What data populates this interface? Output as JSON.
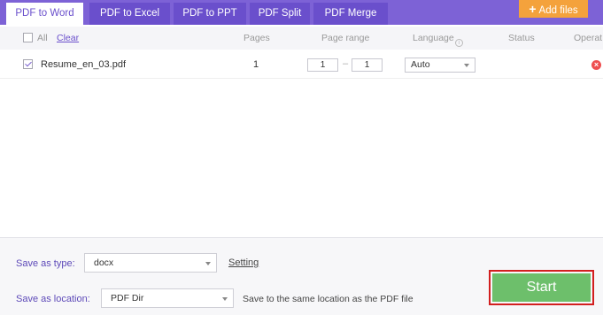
{
  "tabs": [
    {
      "label": "PDF to Word",
      "active": true
    },
    {
      "label": "PDF to Excel",
      "active": false
    },
    {
      "label": "PDF to PPT",
      "active": false
    },
    {
      "label": "PDF Split",
      "active": false
    },
    {
      "label": "PDF Merge",
      "active": false
    }
  ],
  "add_files_label": "Add files",
  "header": {
    "all_label": "All",
    "clear_label": "Clear",
    "pages": "Pages",
    "page_range": "Page range",
    "language": "Language",
    "status": "Status",
    "operation": "Operat"
  },
  "file": {
    "name": "Resume_en_03.pdf",
    "checked": true,
    "pages": "1",
    "range_from": "1",
    "range_to": "1",
    "language": "Auto"
  },
  "bottom": {
    "save_type_label": "Save as type:",
    "save_type_value": "docx",
    "setting_label": "Setting",
    "save_location_label": "Save as location:",
    "save_location_value": "PDF Dir",
    "save_location_note": "Save to the same location as the PDF file",
    "start_label": "Start"
  },
  "colors": {
    "accent": "#7d62d6",
    "add_files": "#f4a23c",
    "start": "#6dbf6b",
    "highlight": "#d21f1f",
    "remove": "#ee4f50"
  }
}
